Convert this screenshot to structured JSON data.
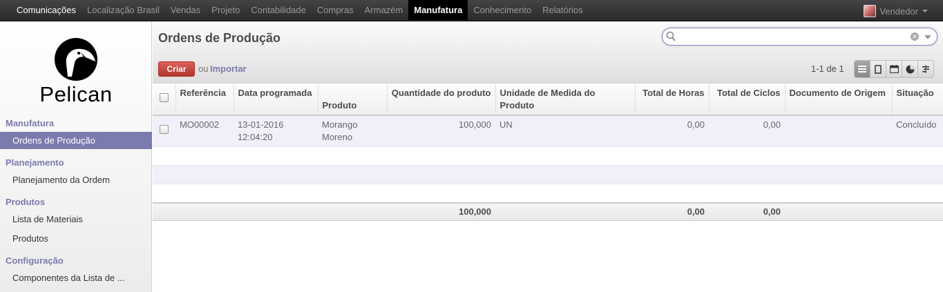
{
  "topmenu": [
    "Comunicações",
    "Localização Brasil",
    "Vendas",
    "Projeto",
    "Contabilidade",
    "Compras",
    "Armazém",
    "Manufatura",
    "Conhecimento",
    "Relatórios"
  ],
  "user": {
    "name": "Vendedor"
  },
  "logo": {
    "text": "Pelican"
  },
  "sidebar": {
    "sections": [
      "Manufatura",
      "Planejamento",
      "Produtos",
      "Configuração"
    ],
    "items": [
      "Ordens de Produção",
      "Planejamento da Ordem",
      "Lista de Materiais",
      "Produtos",
      "Componentes da Lista de ..."
    ]
  },
  "page": {
    "title": "Ordens de Produção",
    "create_label": "Criar",
    "or_label": "ou",
    "import_label": "Importar",
    "pager": "1-1 de 1"
  },
  "search": {
    "value": ""
  },
  "table": {
    "headers": [
      "Referência",
      "Data programada",
      "Produto",
      "Quantidade do produto",
      "Unidade de Medida do Produto",
      "Total de Horas",
      "Total de Ciclos",
      "Documento de Origem",
      "Situação"
    ],
    "rows": [
      [
        "MO00002",
        "13-01-2016 12:04:20",
        "Morango Moreno",
        "100,000",
        "UN",
        "0,00",
        "0,00",
        "",
        "Concluído"
      ]
    ],
    "totals": {
      "quantity": "100,000",
      "hours": "0,00",
      "cycles": "0,00"
    }
  },
  "icons": {
    "search": "search-icon",
    "clear": "clear-icon",
    "views": [
      "list-view-icon",
      "form-view-icon",
      "calendar-view-icon",
      "graph-view-icon",
      "gantt-view-icon"
    ]
  },
  "colors": {
    "accent": "#7c7bad",
    "create": "#c0392b",
    "topbar": "#2b2b2b"
  }
}
